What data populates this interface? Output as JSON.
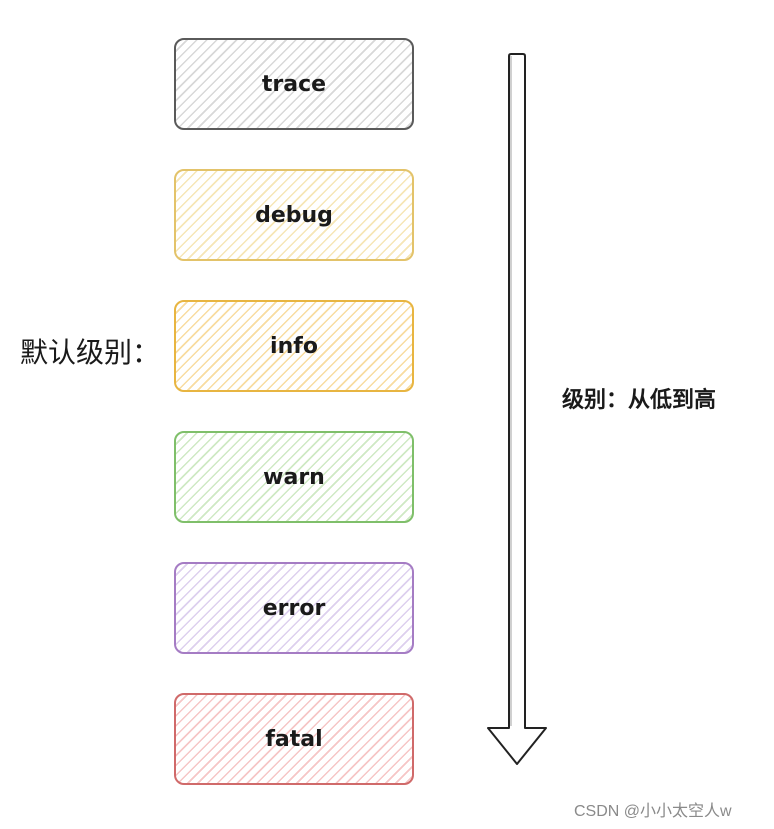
{
  "levels": [
    {
      "label": "trace",
      "border": "#5a5a5a",
      "hatch": "#d8d8d8"
    },
    {
      "label": "debug",
      "border": "#e3c36a",
      "hatch": "#f6e6b6"
    },
    {
      "label": "info",
      "border": "#e8b541",
      "hatch": "#f8dca0"
    },
    {
      "label": "warn",
      "border": "#7fbf6a",
      "hatch": "#cfe9c4"
    },
    {
      "label": "error",
      "border": "#a57cc4",
      "hatch": "#ddd0ee"
    },
    {
      "label": "fatal",
      "border": "#d06a6a",
      "hatch": "#f6c6c6"
    }
  ],
  "default_label": "默认级别：",
  "direction_caption": "级别：从低到高",
  "watermark": "CSDN @小小太空人w"
}
